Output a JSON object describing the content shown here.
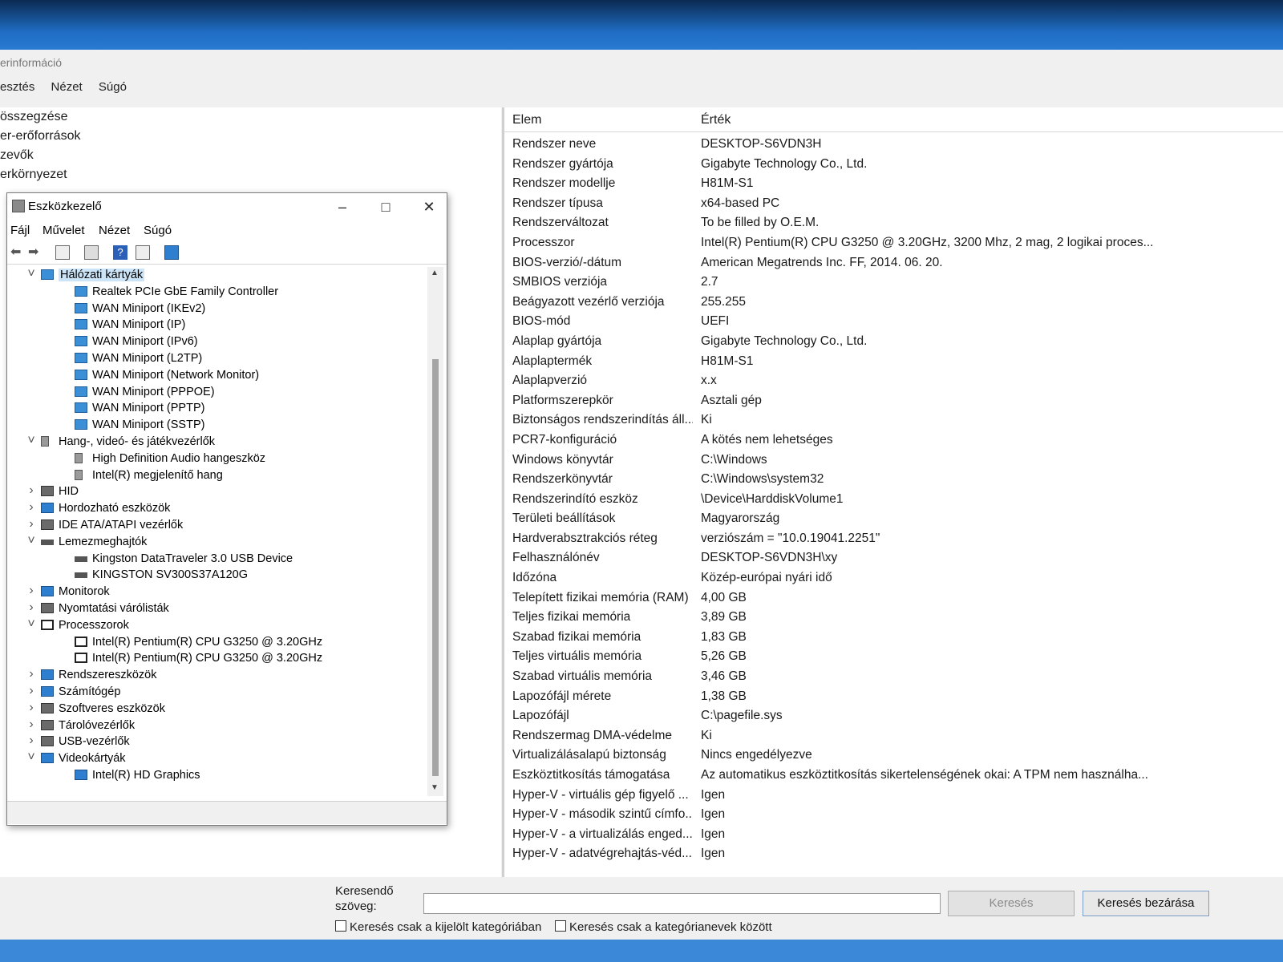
{
  "sysinfo": {
    "title": "erinformáció",
    "menu": [
      "esztés",
      "Nézet",
      "Súgó"
    ],
    "tree": [
      "összegzése",
      "er-erőforrások",
      "zevők",
      "erkörnyezet"
    ],
    "headers": {
      "item": "Elem",
      "value": "Érték"
    },
    "rows": [
      {
        "k": "Rendszer neve",
        "v": "DESKTOP-S6VDN3H"
      },
      {
        "k": "Rendszer gyártója",
        "v": "Gigabyte Technology Co., Ltd."
      },
      {
        "k": "Rendszer modellje",
        "v": "H81M-S1"
      },
      {
        "k": "Rendszer típusa",
        "v": "x64-based PC"
      },
      {
        "k": "Rendszerváltozat",
        "v": "To be filled by O.E.M."
      },
      {
        "k": "Processzor",
        "v": "Intel(R) Pentium(R) CPU G3250 @ 3.20GHz, 3200 Mhz, 2 mag, 2 logikai proces..."
      },
      {
        "k": "BIOS-verzió/-dátum",
        "v": "American Megatrends Inc. FF, 2014. 06. 20."
      },
      {
        "k": "SMBIOS verziója",
        "v": "2.7"
      },
      {
        "k": "Beágyazott vezérlő verziója",
        "v": "255.255"
      },
      {
        "k": "BIOS-mód",
        "v": "UEFI"
      },
      {
        "k": "Alaplap gyártója",
        "v": "Gigabyte Technology Co., Ltd."
      },
      {
        "k": "Alaplaptermék",
        "v": "H81M-S1"
      },
      {
        "k": "Alaplapverzió",
        "v": "x.x"
      },
      {
        "k": "Platformszerepkör",
        "v": "Asztali gép"
      },
      {
        "k": "Biztonságos rendszerindítás áll...",
        "v": "Ki"
      },
      {
        "k": "PCR7-konfiguráció",
        "v": "A kötés nem lehetséges"
      },
      {
        "k": "Windows könyvtár",
        "v": "C:\\Windows"
      },
      {
        "k": "Rendszerkönyvtár",
        "v": "C:\\Windows\\system32"
      },
      {
        "k": "Rendszerindító eszköz",
        "v": "\\Device\\HarddiskVolume1"
      },
      {
        "k": "Területi beállítások",
        "v": "Magyarország"
      },
      {
        "k": "Hardverabsztrakciós réteg",
        "v": "verziószám = \"10.0.19041.2251\""
      },
      {
        "k": "Felhasználónév",
        "v": "DESKTOP-S6VDN3H\\xy"
      },
      {
        "k": "Időzóna",
        "v": "Közép-európai nyári idő"
      },
      {
        "k": "Telepített fizikai memória (RAM)",
        "v": "4,00 GB"
      },
      {
        "k": "Teljes fizikai memória",
        "v": "3,89 GB"
      },
      {
        "k": "Szabad fizikai memória",
        "v": "1,83 GB"
      },
      {
        "k": "Teljes virtuális memória",
        "v": "5,26 GB"
      },
      {
        "k": "Szabad virtuális memória",
        "v": "3,46 GB"
      },
      {
        "k": "Lapozófájl mérete",
        "v": "1,38 GB"
      },
      {
        "k": "Lapozófájl",
        "v": "C:\\pagefile.sys"
      },
      {
        "k": "Rendszermag DMA-védelme",
        "v": "Ki"
      },
      {
        "k": "Virtualizálásalapú biztonság",
        "v": "Nincs engedélyezve"
      },
      {
        "k": "Eszköztitkosítás támogatása",
        "v": "Az automatikus eszköztitkosítás sikertelenségének okai: A TPM nem használha..."
      },
      {
        "k": "Hyper-V - virtuális gép figyelő ...",
        "v": "Igen"
      },
      {
        "k": "Hyper-V - második szintű címfo...",
        "v": "Igen"
      },
      {
        "k": "Hyper-V - a virtualizálás enged...",
        "v": "Igen"
      },
      {
        "k": "Hyper-V - adatvégrehajtás-véd...",
        "v": "Igen"
      }
    ],
    "search": {
      "label": "Keresendő szöveg:",
      "value": "",
      "search_button": "Keresés",
      "close_button": "Keresés bezárása",
      "check_selected": "Keresés csak a kijelölt kategóriában",
      "check_names": "Keresés csak a kategórianevek között"
    }
  },
  "devmgr": {
    "title": "Eszközkezelő",
    "menu": [
      "Fájl",
      "Művelet",
      "Nézet",
      "Súgó"
    ],
    "tree": [
      {
        "label": "Hálózati kártyák",
        "level": 0,
        "exp": "open",
        "icon": "net",
        "sel": true
      },
      {
        "label": "Realtek PCIe GbE Family Controller",
        "level": 1,
        "icon": "net"
      },
      {
        "label": "WAN Miniport (IKEv2)",
        "level": 1,
        "icon": "net"
      },
      {
        "label": "WAN Miniport (IP)",
        "level": 1,
        "icon": "net"
      },
      {
        "label": "WAN Miniport (IPv6)",
        "level": 1,
        "icon": "net"
      },
      {
        "label": "WAN Miniport (L2TP)",
        "level": 1,
        "icon": "net"
      },
      {
        "label": "WAN Miniport (Network Monitor)",
        "level": 1,
        "icon": "net"
      },
      {
        "label": "WAN Miniport (PPPOE)",
        "level": 1,
        "icon": "net"
      },
      {
        "label": "WAN Miniport (PPTP)",
        "level": 1,
        "icon": "net"
      },
      {
        "label": "WAN Miniport (SSTP)",
        "level": 1,
        "icon": "net"
      },
      {
        "label": "Hang-, videó- és játékvezérlők",
        "level": 0,
        "exp": "open",
        "icon": "audio"
      },
      {
        "label": "High Definition Audio hangeszköz",
        "level": 1,
        "icon": "audio"
      },
      {
        "label": "Intel(R) megjelenítő hang",
        "level": 1,
        "icon": "audio"
      },
      {
        "label": "HID",
        "level": 0,
        "exp": "closed",
        "icon": "gray"
      },
      {
        "label": "Hordozható eszközök",
        "level": 0,
        "exp": "closed",
        "icon": "mon"
      },
      {
        "label": "IDE ATA/ATAPI vezérlők",
        "level": 0,
        "exp": "closed",
        "icon": "gray"
      },
      {
        "label": "Lemezmeghajtók",
        "level": 0,
        "exp": "open",
        "icon": "disk"
      },
      {
        "label": "Kingston DataTraveler 3.0 USB Device",
        "level": 1,
        "icon": "disk"
      },
      {
        "label": "KINGSTON SV300S37A120G",
        "level": 1,
        "icon": "disk"
      },
      {
        "label": "Monitorok",
        "level": 0,
        "exp": "closed",
        "icon": "mon"
      },
      {
        "label": "Nyomtatási várólisták",
        "level": 0,
        "exp": "closed",
        "icon": "gray"
      },
      {
        "label": "Processzorok",
        "level": 0,
        "exp": "open",
        "icon": "cpu"
      },
      {
        "label": "Intel(R) Pentium(R) CPU G3250 @ 3.20GHz",
        "level": 1,
        "icon": "cpu"
      },
      {
        "label": "Intel(R) Pentium(R) CPU G3250 @ 3.20GHz",
        "level": 1,
        "icon": "cpu"
      },
      {
        "label": "Rendszereszközök",
        "level": 0,
        "exp": "closed",
        "icon": "mon"
      },
      {
        "label": "Számítógép",
        "level": 0,
        "exp": "closed",
        "icon": "mon"
      },
      {
        "label": "Szoftveres eszközök",
        "level": 0,
        "exp": "closed",
        "icon": "gray"
      },
      {
        "label": "Tárolóvezérlők",
        "level": 0,
        "exp": "closed",
        "icon": "gray"
      },
      {
        "label": "USB-vezérlők",
        "level": 0,
        "exp": "closed",
        "icon": "gray"
      },
      {
        "label": "Videokártyák",
        "level": 0,
        "exp": "open",
        "icon": "mon"
      },
      {
        "label": "Intel(R) HD Graphics",
        "level": 1,
        "icon": "mon"
      }
    ]
  }
}
